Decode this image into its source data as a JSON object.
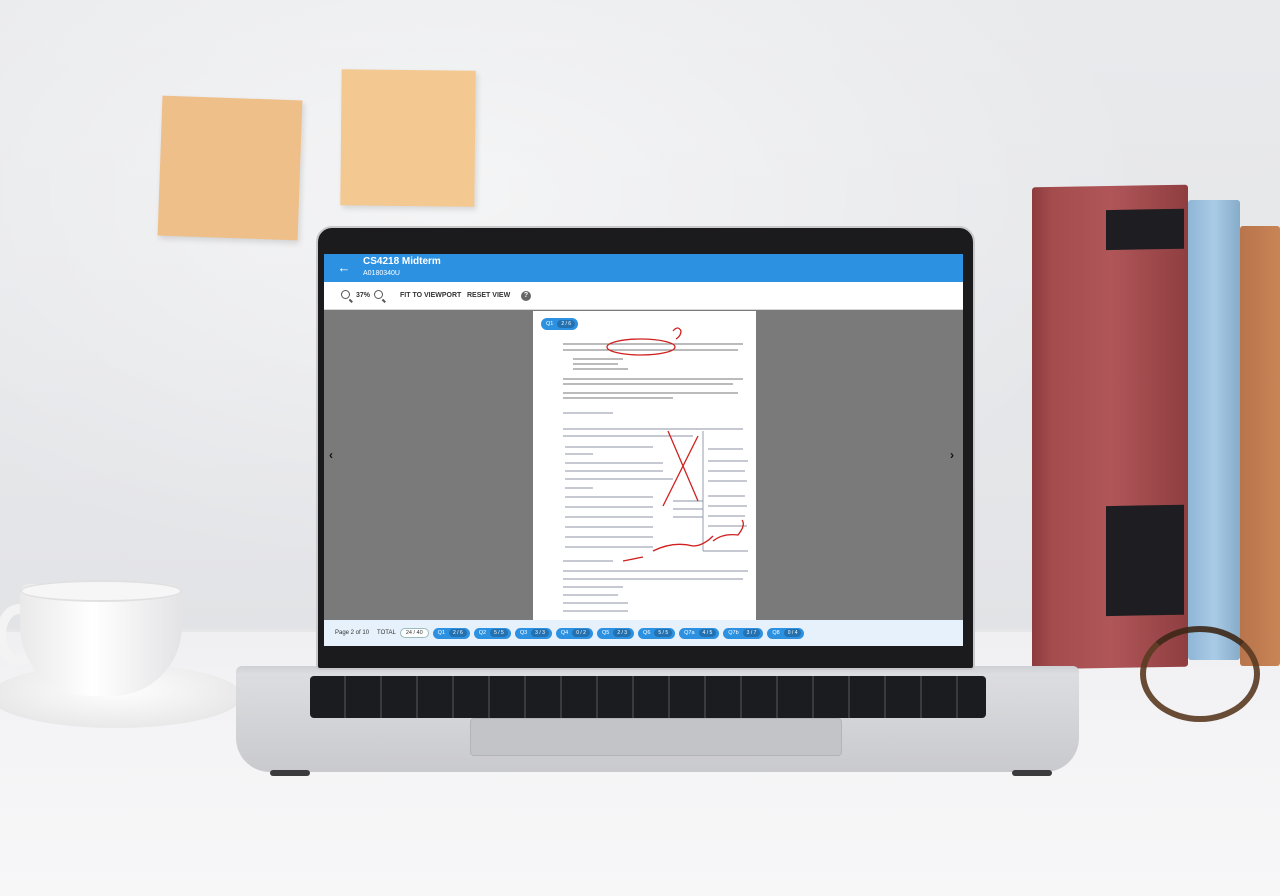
{
  "app": {
    "title": "CS4218 Midterm",
    "subtitle": "A0180340U"
  },
  "toolbar": {
    "zoom_level": "37%",
    "fit_label": "FIT TO VIEWPORT",
    "reset_label": "RESET VIEW",
    "help_glyph": "?"
  },
  "page_chip": {
    "label": "Q1",
    "count": "2 / 6"
  },
  "status": {
    "page_text": "Page 2 of 10",
    "total_label": "TOTAL",
    "total_value": "24 / 40"
  },
  "questions": [
    {
      "label": "Q1",
      "count": "2 / 6"
    },
    {
      "label": "Q2",
      "count": "5 / 5"
    },
    {
      "label": "Q3",
      "count": "3 / 3"
    },
    {
      "label": "Q4",
      "count": "0 / 2"
    },
    {
      "label": "Q5",
      "count": "2 / 3"
    },
    {
      "label": "Q6",
      "count": "5 / 5"
    },
    {
      "label": "Q7a",
      "count": "4 / 5"
    },
    {
      "label": "Q7b",
      "count": "3 / 7"
    },
    {
      "label": "Q8",
      "count": "0 / 4"
    }
  ],
  "colors": {
    "accent": "#2d91e2",
    "viewer_bg": "#7a7a7a",
    "bottom_bar": "#e6f1fb"
  }
}
